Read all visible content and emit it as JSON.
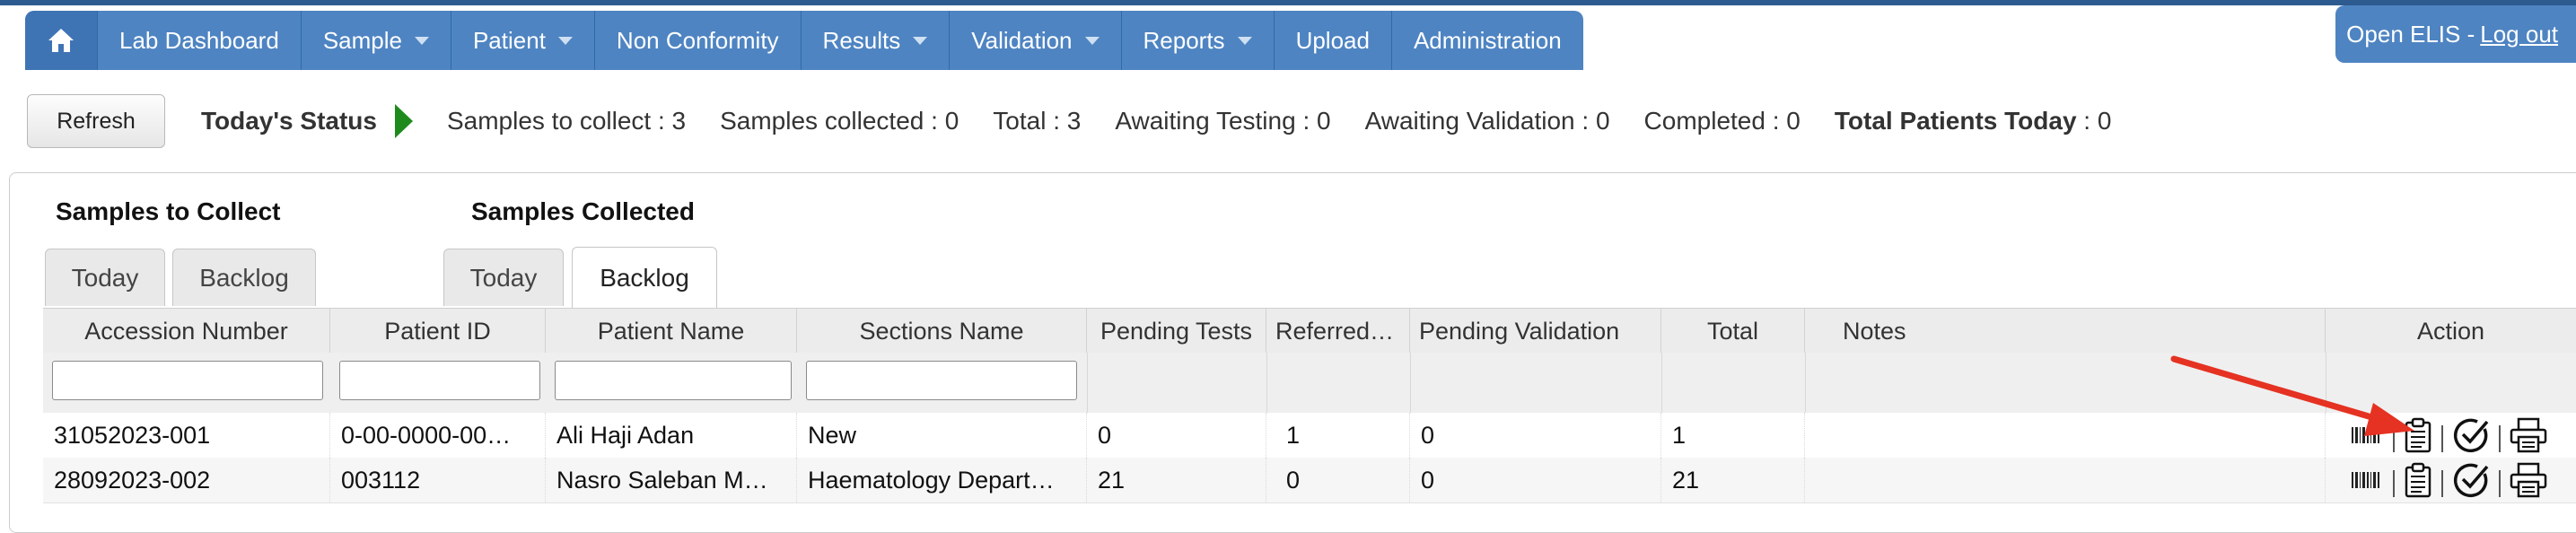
{
  "nav": {
    "items": [
      {
        "label": "Lab Dashboard",
        "dropdown": false
      },
      {
        "label": "Sample",
        "dropdown": true
      },
      {
        "label": "Patient",
        "dropdown": true
      },
      {
        "label": "Non Conformity",
        "dropdown": false
      },
      {
        "label": "Results",
        "dropdown": true
      },
      {
        "label": "Validation",
        "dropdown": true
      },
      {
        "label": "Reports",
        "dropdown": true
      },
      {
        "label": "Upload",
        "dropdown": false
      },
      {
        "label": "Administration",
        "dropdown": false
      }
    ],
    "brand": "Open ELIS -",
    "logout": "Log out",
    "home_icon": "home-icon"
  },
  "status": {
    "refresh_label": "Refresh",
    "title": "Today's Status",
    "stats": [
      {
        "label": "Samples to collect",
        "value": "3"
      },
      {
        "label": "Samples collected",
        "value": "0"
      },
      {
        "label": "Total",
        "value": "3"
      },
      {
        "label": "Awaiting Testing",
        "value": "0"
      },
      {
        "label": "Awaiting Validation",
        "value": "0"
      },
      {
        "label": "Completed",
        "value": "0"
      },
      {
        "label": "Total Patients Today",
        "value": "0"
      }
    ],
    "arrow_color": "#1e8a1e"
  },
  "panel": {
    "to_collect_title": "Samples to Collect",
    "collected_title": "Samples Collected",
    "to_collect_tabs": [
      "Today",
      "Backlog"
    ],
    "collected_tabs": [
      "Today",
      "Backlog"
    ],
    "collected_active_tab": "Backlog"
  },
  "table": {
    "columns": [
      "Accession Number",
      "Patient ID",
      "Patient Name",
      "Sections Name",
      "Pending Tests",
      "Referred…",
      "Pending Validation",
      "Total",
      "Notes",
      "Action"
    ],
    "rows": [
      [
        "31052023-001",
        "0-00-0000-00…",
        "Ali Haji Adan",
        "New",
        "0",
        "1",
        "0",
        "1",
        ""
      ],
      [
        "28092023-002",
        "003112",
        "Nasro Saleban M…",
        "Haematology Depart…",
        "21",
        "0",
        "0",
        "21",
        ""
      ]
    ],
    "action_icons": [
      "barcode-icon",
      "clipboard-icon",
      "check-circle-icon",
      "printer-icon"
    ]
  },
  "annotation": {
    "color": "#e53222"
  }
}
